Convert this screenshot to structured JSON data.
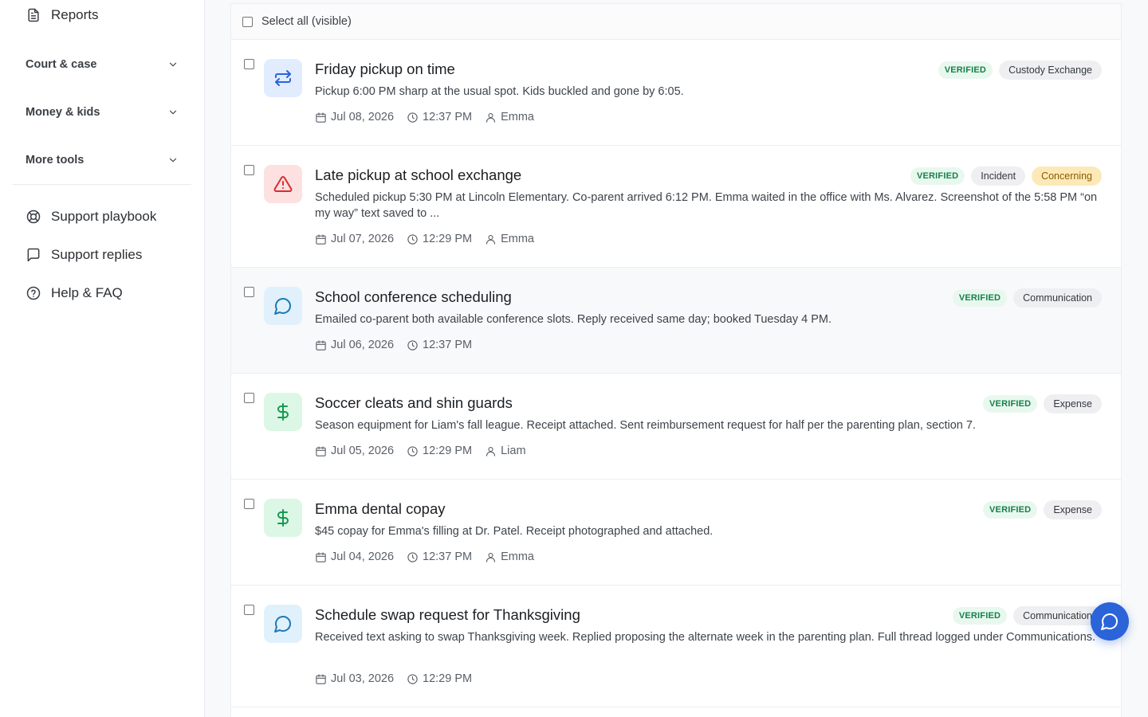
{
  "sidebar": {
    "reports": "Reports",
    "groups": [
      "Court & case",
      "Money & kids",
      "More tools"
    ],
    "support_playbook": "Support playbook",
    "support_replies": "Support replies",
    "help_faq": "Help & FAQ"
  },
  "list": {
    "select_all_label": "Select all (visible)",
    "items": [
      {
        "title": "Friday pickup on time",
        "description": "Pickup 6:00 PM sharp at the usual spot. Kids buckled and gone by 6:05.",
        "date": "Jul 08, 2026",
        "time": "12:37 PM",
        "person": "Emma",
        "verified": "VERIFIED",
        "category": "Custody Exchange",
        "icon": "swap-arrows-icon"
      },
      {
        "title": "Late pickup at school exchange",
        "description": "Scheduled pickup 5:30 PM at Lincoln Elementary. Co-parent arrived 6:12 PM. Emma waited in the office with Ms. Alvarez. Screenshot of the 5:58 PM “on my way” text saved to ...",
        "date": "Jul 07, 2026",
        "time": "12:29 PM",
        "person": "Emma",
        "verified": "VERIFIED",
        "category": "Incident",
        "flag": "Concerning",
        "icon": "warning-triangle-icon"
      },
      {
        "title": "School conference scheduling",
        "description": "Emailed co-parent both available conference slots. Reply received same day; booked Tuesday 4 PM.",
        "date": "Jul 06, 2026",
        "time": "12:37 PM",
        "verified": "VERIFIED",
        "category": "Communication",
        "icon": "chat-bubble-icon"
      },
      {
        "title": "Soccer cleats and shin guards",
        "description": "Season equipment for Liam's fall league. Receipt attached. Sent reimbursement request for half per the parenting plan, section 7.",
        "date": "Jul 05, 2026",
        "time": "12:29 PM",
        "person": "Liam",
        "verified": "VERIFIED",
        "category": "Expense",
        "icon": "dollar-icon"
      },
      {
        "title": "Emma dental copay",
        "description": "$45 copay for Emma's filling at Dr. Patel. Receipt photographed and attached.",
        "date": "Jul 04, 2026",
        "time": "12:37 PM",
        "person": "Emma",
        "verified": "VERIFIED",
        "category": "Expense",
        "icon": "dollar-icon"
      },
      {
        "title": "Schedule swap request for Thanksgiving",
        "description": "Received text asking to swap Thanksgiving week. Replied proposing the alternate week in the parenting plan. Full thread logged under Communications.",
        "date": "Jul 03, 2026",
        "time": "12:29 PM",
        "verified": "VERIFIED",
        "category": "Communication",
        "icon": "chat-bubble-icon"
      }
    ]
  }
}
